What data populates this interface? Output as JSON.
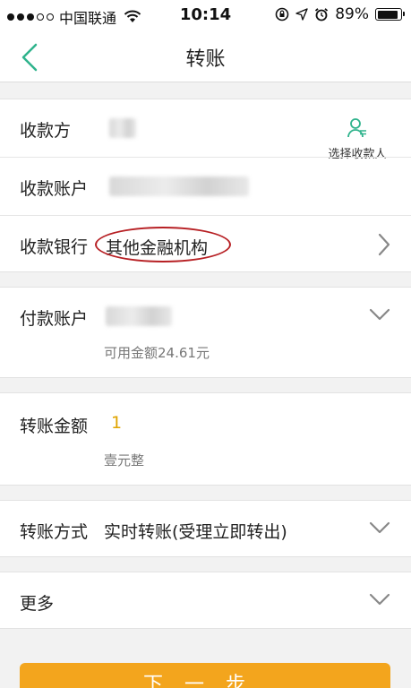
{
  "status_bar": {
    "carrier": "中国联通",
    "time": "10:14",
    "battery": "89%",
    "battery_level": 0.89
  },
  "nav": {
    "title": "转账",
    "back_icon": "chevron-left-icon",
    "accent_color": "#2fb38c"
  },
  "payee_section": {
    "payee_label": "收款方",
    "select_payee_label": "选择收款人",
    "account_label": "收款账户",
    "bank_label": "收款银行",
    "bank_value": "其他金融机构"
  },
  "payer_section": {
    "account_label": "付款账户",
    "available_balance": "可用金额24.61元"
  },
  "amount_section": {
    "label": "转账金额",
    "value": "1",
    "value_color": "#e0a400",
    "chinese_amount": "壹元整"
  },
  "method_section": {
    "label": "转账方式",
    "value": "实时转账(受理立即转出)"
  },
  "more_section": {
    "label": "更多"
  },
  "next_button": {
    "label": "下一步",
    "color": "#f3a51d"
  }
}
